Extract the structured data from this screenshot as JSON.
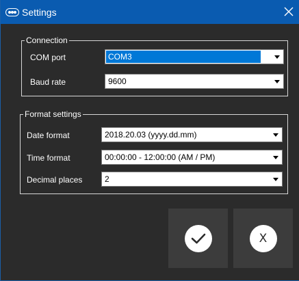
{
  "window": {
    "title": "Settings",
    "icon": "pce-logo-icon",
    "title_bar_color": "#0a5bb0"
  },
  "connection": {
    "legend": "Connection",
    "com_port": {
      "label": "COM port",
      "value": "COM3"
    },
    "baud_rate": {
      "label": "Baud rate",
      "value": "9600"
    }
  },
  "format_settings": {
    "legend": "Format settings",
    "date_format": {
      "label": "Date format",
      "value": "2018.20.03 (yyyy.dd.mm)"
    },
    "time_format": {
      "label": "Time format",
      "value": "00:00:00 - 12:00:00 (AM / PM)"
    },
    "decimal_places": {
      "label": "Decimal places",
      "value": "2"
    }
  },
  "buttons": {
    "ok_icon": "checkmark-icon",
    "cancel_icon": "x-icon",
    "cancel_glyph": "X"
  },
  "colors": {
    "background": "#2b2b2b",
    "button_bg": "#3c3c3c",
    "selection": "#0078d7"
  }
}
